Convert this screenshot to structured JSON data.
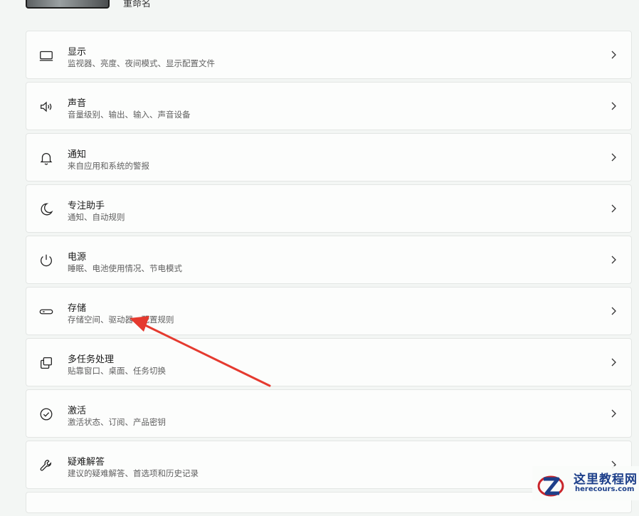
{
  "header": {
    "rename_label": "重命名"
  },
  "items": [
    {
      "title": "显示",
      "desc": "监视器、亮度、夜间模式、显示配置文件",
      "icon": "monitor-icon"
    },
    {
      "title": "声音",
      "desc": "音量级别、输出、输入、声音设备",
      "icon": "speaker-icon"
    },
    {
      "title": "通知",
      "desc": "来自应用和系统的警报",
      "icon": "bell-icon"
    },
    {
      "title": "专注助手",
      "desc": "通知、自动规则",
      "icon": "moon-icon"
    },
    {
      "title": "电源",
      "desc": "睡眠、电池使用情况、节电模式",
      "icon": "power-icon"
    },
    {
      "title": "存储",
      "desc": "存储空间、驱动器、配置规则",
      "icon": "storage-icon"
    },
    {
      "title": "多任务处理",
      "desc": "贴靠窗口、桌面、任务切换",
      "icon": "multitask-icon"
    },
    {
      "title": "激活",
      "desc": "激活状态、订阅、产品密钥",
      "icon": "check-circle-icon"
    },
    {
      "title": "疑难解答",
      "desc": "建议的疑难解答、首选项和历史记录",
      "icon": "wrench-icon"
    }
  ],
  "annotation": {
    "color": "#e53a2f"
  },
  "watermark": {
    "name": "这里教程网",
    "url": "herecours.com",
    "color": "#1d3f8a"
  }
}
